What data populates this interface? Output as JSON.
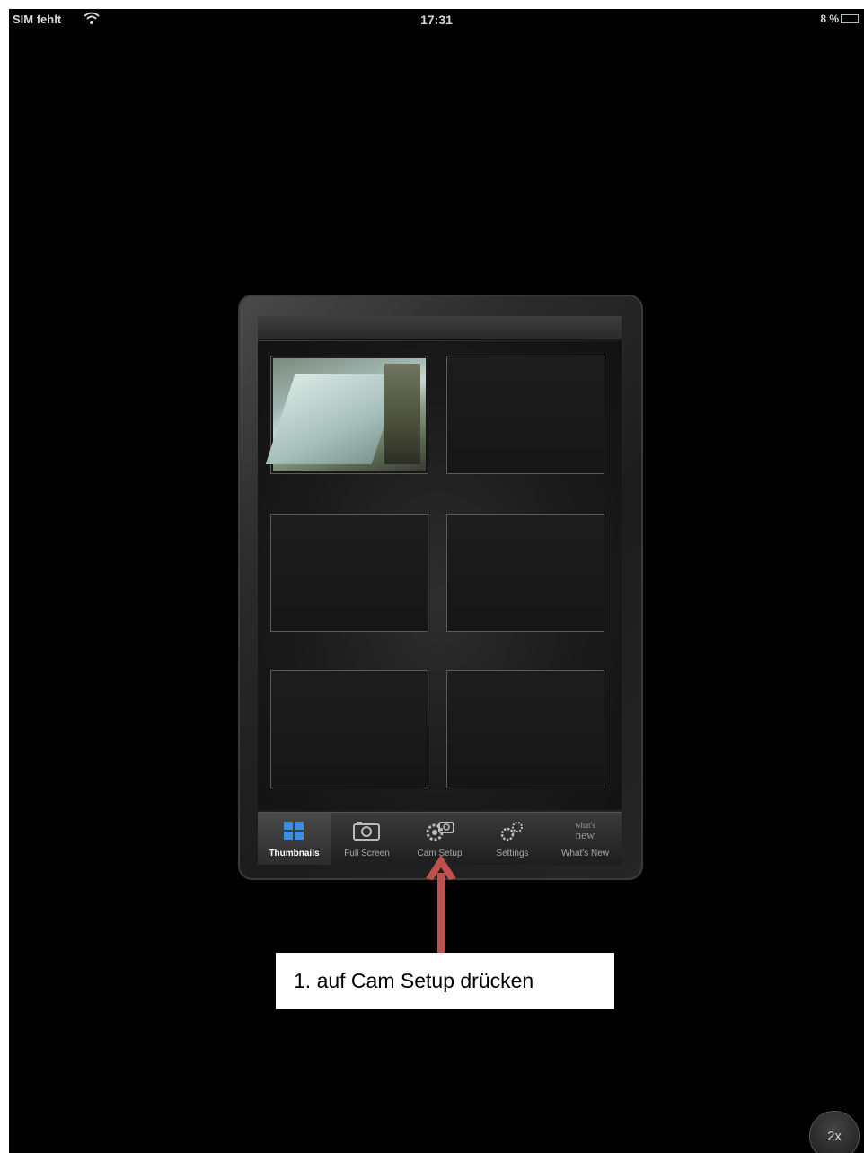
{
  "status_bar": {
    "carrier": "SIM fehlt",
    "time": "17:31",
    "battery": "8 %",
    "battery_level": 0.08,
    "battery_color": "#d02020"
  },
  "camera_grid": {
    "cells": [
      {
        "id": "cam-1",
        "has_feed": true
      },
      {
        "id": "cam-2",
        "has_feed": false
      },
      {
        "id": "cam-3",
        "has_feed": false
      },
      {
        "id": "cam-4",
        "has_feed": false
      },
      {
        "id": "cam-5",
        "has_feed": false
      },
      {
        "id": "cam-6",
        "has_feed": false
      }
    ]
  },
  "tabbar": {
    "selected": "Thumbnails",
    "tabs": [
      {
        "label": "Thumbnails",
        "icon": "grid-icon"
      },
      {
        "label": "Full Screen",
        "icon": "camera-icon"
      },
      {
        "label": "Cam Setup",
        "icon": "cam-setup-icon"
      },
      {
        "label": "Settings",
        "icon": "gears-icon"
      },
      {
        "label": "What's New",
        "icon": "whats-new-icon",
        "icon_text": "what's new"
      }
    ]
  },
  "annotation": {
    "callout_text": "1. auf Cam Setup drücken",
    "arrow_color": "#c0504d"
  },
  "zoom_button": {
    "label": "2x"
  }
}
